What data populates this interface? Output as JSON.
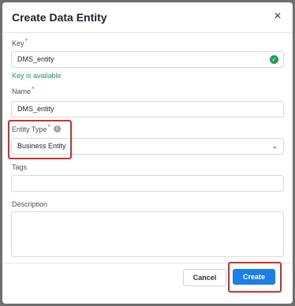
{
  "dialog": {
    "title": "Create Data Entity",
    "close_glyph": "×"
  },
  "fields": {
    "key": {
      "label": "Key",
      "required_mark": "*",
      "value": "DMS_entity",
      "status": "Key is available"
    },
    "name": {
      "label": "Name",
      "required_mark": "*",
      "value": "DMS_entity"
    },
    "entity_type": {
      "label": "Entity Type",
      "required_mark": "*",
      "info_glyph": "i",
      "value": "Business Entity"
    },
    "tags": {
      "label": "Tags",
      "value": ""
    },
    "description": {
      "label": "Description",
      "value": ""
    }
  },
  "buttons": {
    "cancel": "Cancel",
    "create": "Create"
  },
  "colors": {
    "primary": "#1e7ee8",
    "success": "#1f9d55",
    "required": "#e5533d",
    "highlight": "#d32f2f"
  }
}
